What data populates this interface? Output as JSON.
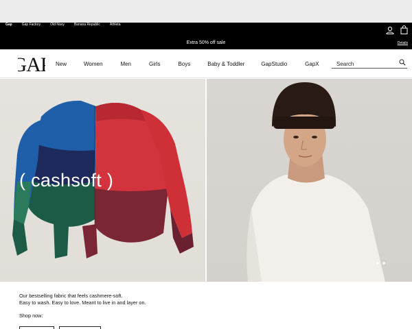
{
  "brands": [
    "Gap",
    "Gap Factory",
    "Old Navy",
    "Banana Republic",
    "Athleta"
  ],
  "promo": {
    "text": "Extra 50% off sale",
    "details": "Details"
  },
  "logo_text": "GAP",
  "nav": [
    "New",
    "Women",
    "Men",
    "Girls",
    "Boys",
    "Baby & Toddler",
    "GapStudio",
    "GapX"
  ],
  "search": {
    "placeholder": "Search"
  },
  "hero": {
    "title": "( cashsoft )"
  },
  "description": {
    "line1": "Our bestselling fabric that feels cashmere-soft.",
    "line2": "Easy to wash. Easy to love. Meant to live in and layer on."
  },
  "shop_now": "Shop now:",
  "colors": {
    "promo_bg": "#000000",
    "white": "#ffffff"
  },
  "icons": [
    "account-icon",
    "bag-icon",
    "search-icon"
  ]
}
